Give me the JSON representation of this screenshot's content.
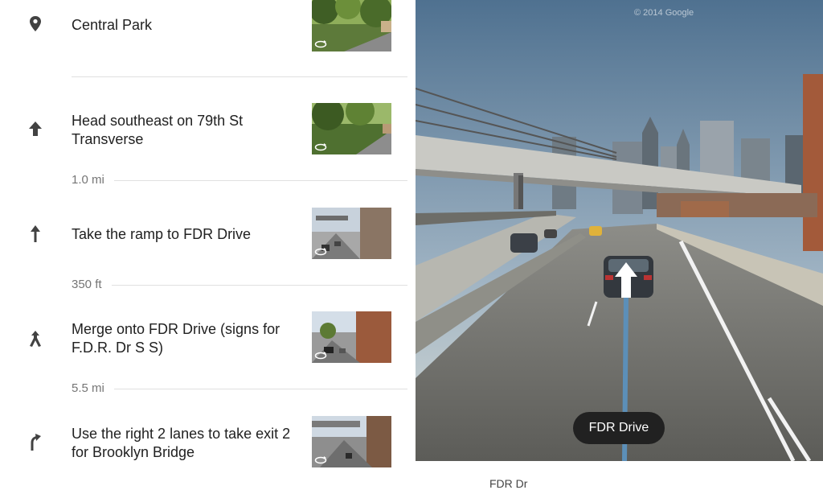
{
  "steps": [
    {
      "icon": "location-pin-icon",
      "text": "Central Park"
    },
    {
      "icon": "head-arrow-up-icon",
      "text": "Head southeast on 79th St Transverse",
      "distance": "1.0 mi"
    },
    {
      "icon": "straight-arrow-icon",
      "text": "Take the ramp to FDR Drive",
      "distance": "350 ft"
    },
    {
      "icon": "merge-icon",
      "text": "Merge onto FDR Drive (signs for F.D.R. Dr S S)",
      "distance": "5.5 mi"
    },
    {
      "icon": "slight-right-icon",
      "text": "Use the right 2 lanes to take exit 2 for Brooklyn Bridge"
    }
  ],
  "street_view": {
    "road_label": "FDR Drive",
    "watermark": "© 2014 Google",
    "direction_icon": "street-view-arrow-icon",
    "below_peek": "FDR Dr"
  },
  "colors": {
    "text": "#212121",
    "secondary_text": "#757575",
    "divider": "#e0e0e0",
    "chip_bg": "#212121"
  }
}
